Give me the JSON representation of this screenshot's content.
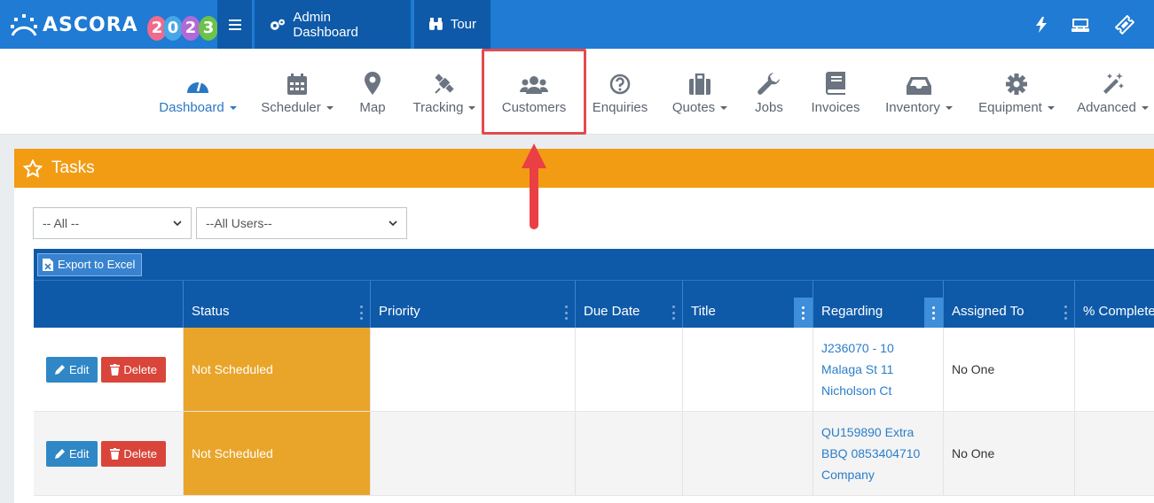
{
  "topbar": {
    "logo_text": "ASCORA",
    "logo_year_digits": [
      "2",
      "0",
      "2",
      "3"
    ],
    "menu_icon": "hamburger-icon",
    "buttons": [
      {
        "label": "Admin Dashboard",
        "icon": "cogs-icon"
      },
      {
        "label": "Tour",
        "icon": "binoculars-icon"
      }
    ],
    "right_icons": [
      "bolt-icon",
      "cash-register-icon",
      "ticket-icon"
    ],
    "color": "#1f7bd3"
  },
  "nav": {
    "items": [
      {
        "label": "Dashboard",
        "icon": "gauge-icon",
        "dropdown": true,
        "active": true
      },
      {
        "label": "Scheduler",
        "icon": "calendar-icon",
        "dropdown": true
      },
      {
        "label": "Map",
        "icon": "map-marker-icon",
        "dropdown": false
      },
      {
        "label": "Tracking",
        "icon": "satellite-icon",
        "dropdown": true
      },
      {
        "label": "Customers",
        "icon": "users-icon",
        "dropdown": false,
        "highlighted": true
      },
      {
        "label": "Enquiries",
        "icon": "question-circle-icon",
        "dropdown": false
      },
      {
        "label": "Quotes",
        "icon": "briefcase-icon",
        "dropdown": true
      },
      {
        "label": "Jobs",
        "icon": "wrench-icon",
        "dropdown": false
      },
      {
        "label": "Invoices",
        "icon": "book-icon",
        "dropdown": false
      },
      {
        "label": "Inventory",
        "icon": "inbox-icon",
        "dropdown": true
      },
      {
        "label": "Equipment",
        "icon": "gear-icon",
        "dropdown": true
      },
      {
        "label": "Advanced",
        "icon": "magic-wand-icon",
        "dropdown": true
      }
    ]
  },
  "tasks": {
    "title": "Tasks",
    "header_color": "#f29c13",
    "filters": {
      "status": "-- All --",
      "users": "--All Users--"
    },
    "export_label": "Export to Excel",
    "columns": [
      "",
      "Status",
      "Priority",
      "Due Date",
      "Title",
      "Regarding",
      "Assigned To",
      "% Complete"
    ],
    "rows": [
      {
        "edit": "Edit",
        "delete": "Delete",
        "status": "Not Scheduled",
        "priority": "",
        "due_date": "",
        "title": "",
        "regarding": [
          "J236070 - 10",
          "Malaga St 11",
          "Nicholson Ct"
        ],
        "assigned_to": "No One",
        "complete": ""
      },
      {
        "edit": "Edit",
        "delete": "Delete",
        "status": "Not Scheduled",
        "priority": "",
        "due_date": "",
        "title": "",
        "regarding": [
          "QU159890 Extra",
          "BBQ 0853404710",
          "Company"
        ],
        "assigned_to": "No One",
        "complete": ""
      }
    ]
  }
}
